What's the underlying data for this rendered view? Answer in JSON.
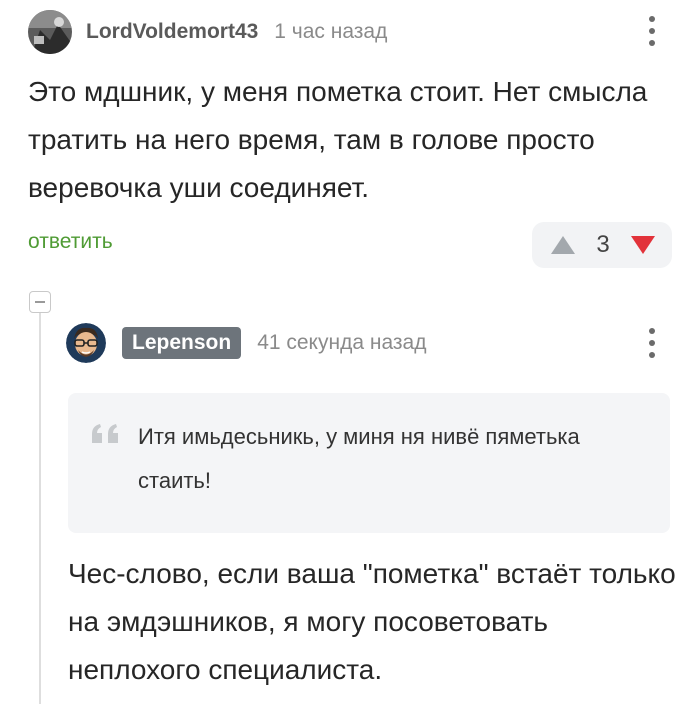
{
  "comment": {
    "author": "LordVoldemort43",
    "timestamp": "1 час назад",
    "avatar_icon": "grayscale-photo-avatar",
    "text": "Это мдшник, у меня пометка стоит. Нет смысла тратить на него время, там в голове просто веревочка уши соединяет.",
    "reply_label": "ответить",
    "rating": "3",
    "menu_icon": "vertical-dots-icon"
  },
  "reply": {
    "author": "Lepenson",
    "timestamp": "41 секунда назад",
    "avatar_icon": "cartoon-face-avatar",
    "quote": "Итя имьдесьникь, у миня ня нивё пяметька стаить!",
    "text": "Чес-слово, если ваша \"пометка\" встаёт только на эмдэшников, я могу посоветовать неплохого специалиста.",
    "menu_icon": "vertical-dots-icon"
  },
  "colors": {
    "reply_link": "#4f9b34",
    "vote_down": "#e2323a",
    "vote_up": "#a3a8ad",
    "author_badge": "#6d747b",
    "quote_background": "#f4f5f7"
  }
}
